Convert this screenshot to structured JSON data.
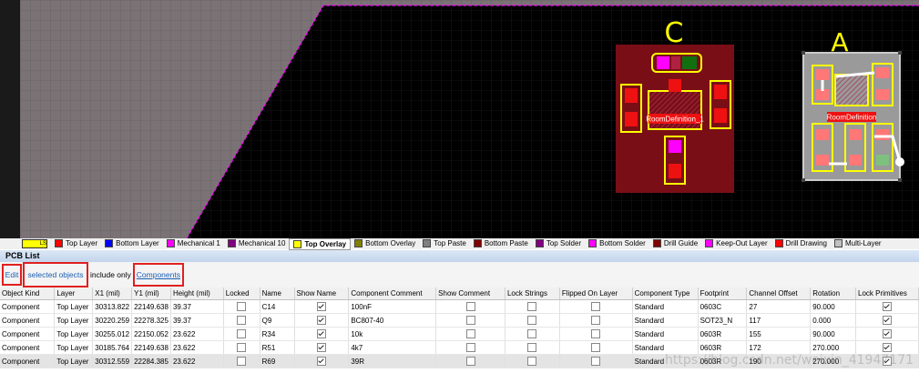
{
  "canvas": {
    "room_labels": [
      "RoomDefinition_1",
      "RoomDefinition"
    ],
    "designators": [
      "C",
      "A"
    ]
  },
  "layer_bar": {
    "current": "LS",
    "layers": [
      {
        "name": "Top Layer",
        "color": "#ff0000"
      },
      {
        "name": "Bottom Layer",
        "color": "#0000ff"
      },
      {
        "name": "Mechanical 1",
        "color": "#ff00ff"
      },
      {
        "name": "Mechanical 10",
        "color": "#800080"
      },
      {
        "name": "Top Overlay",
        "color": "#ffff00",
        "active": true
      },
      {
        "name": "Bottom Overlay",
        "color": "#808000"
      },
      {
        "name": "Top Paste",
        "color": "#808080"
      },
      {
        "name": "Bottom Paste",
        "color": "#800000"
      },
      {
        "name": "Top Solder",
        "color": "#800080"
      },
      {
        "name": "Bottom Solder",
        "color": "#ff00ff"
      },
      {
        "name": "Drill Guide",
        "color": "#800000"
      },
      {
        "name": "Keep-Out Layer",
        "color": "#ff00ff"
      },
      {
        "name": "Drill Drawing",
        "color": "#ff0000"
      },
      {
        "name": "Multi-Layer",
        "color": "#c0c0c0"
      }
    ]
  },
  "panel": {
    "title": "PCB List",
    "mode": "Edit",
    "scope": "selected objects",
    "include_text": "include only",
    "filter": "Components"
  },
  "table": {
    "columns": [
      "Object Kind",
      "Layer",
      "X1 (mil)",
      "Y1 (mil)",
      "Height (mil)",
      "Locked",
      "Name",
      "Show Name",
      "Component Comment",
      "Show Comment",
      "Lock Strings",
      "Flipped On Layer",
      "Component Type",
      "Footprint",
      "Channel Offset",
      "Rotation",
      "Lock Primitives"
    ],
    "rows": [
      {
        "kind": "Component",
        "layer": "Top Layer",
        "x1": "30313.822",
        "y1": "22149.638",
        "height": "39.37",
        "locked": false,
        "name": "C14",
        "show_name": true,
        "comment": "100nF",
        "show_comment": false,
        "lock_strings": false,
        "flipped": false,
        "type": "Standard",
        "footprint": "0603C",
        "offset": "27",
        "rotation": "90.000",
        "lock_prim": true
      },
      {
        "kind": "Component",
        "layer": "Top Layer",
        "x1": "30220.259",
        "y1": "22278.325",
        "height": "39.37",
        "locked": false,
        "name": "Q9",
        "show_name": true,
        "comment": "BC807-40",
        "show_comment": false,
        "lock_strings": false,
        "flipped": false,
        "type": "Standard",
        "footprint": "SOT23_N",
        "offset": "117",
        "rotation": "0.000",
        "lock_prim": true
      },
      {
        "kind": "Component",
        "layer": "Top Layer",
        "x1": "30255.012",
        "y1": "22150.052",
        "height": "23.622",
        "locked": false,
        "name": "R34",
        "show_name": true,
        "comment": "10k",
        "show_comment": false,
        "lock_strings": false,
        "flipped": false,
        "type": "Standard",
        "footprint": "0603R",
        "offset": "155",
        "rotation": "90.000",
        "lock_prim": true
      },
      {
        "kind": "Component",
        "layer": "Top Layer",
        "x1": "30185.764",
        "y1": "22149.638",
        "height": "23.622",
        "locked": false,
        "name": "R51",
        "show_name": true,
        "comment": "4k7",
        "show_comment": false,
        "lock_strings": false,
        "flipped": false,
        "type": "Standard",
        "footprint": "0603R",
        "offset": "172",
        "rotation": "270.000",
        "lock_prim": true
      },
      {
        "kind": "Component",
        "layer": "Top Layer",
        "x1": "30312.559",
        "y1": "22284.385",
        "height": "23.622",
        "locked": false,
        "name": "R69",
        "show_name": true,
        "comment": "39R",
        "show_comment": false,
        "lock_strings": false,
        "flipped": false,
        "type": "Standard",
        "footprint": "0603R",
        "offset": "190",
        "rotation": "270.000",
        "lock_prim": true
      }
    ]
  },
  "watermark": "https://blog.csdn.net/weixin_41947171"
}
